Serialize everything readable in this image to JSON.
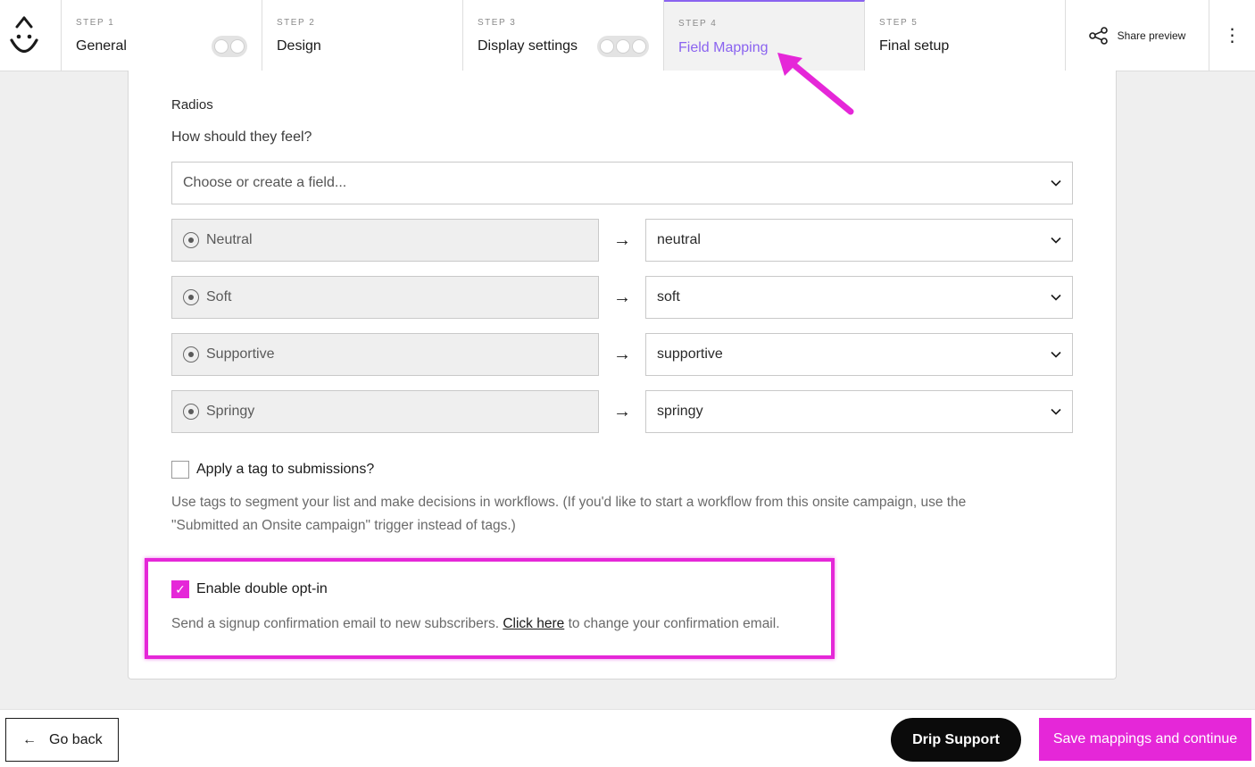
{
  "header": {
    "steps": [
      {
        "num": "STEP 1",
        "title": "General"
      },
      {
        "num": "STEP 2",
        "title": "Design"
      },
      {
        "num": "STEP 3",
        "title": "Display settings"
      },
      {
        "num": "STEP 4",
        "title": "Field Mapping"
      },
      {
        "num": "STEP 5",
        "title": "Final setup"
      }
    ],
    "share_label": "Share preview",
    "more_icon": "⋮"
  },
  "mapping": {
    "section_label": "Radios",
    "question": "How should they feel?",
    "field_select_placeholder": "Choose or create a field...",
    "rows": [
      {
        "option": "Neutral",
        "value": "neutral"
      },
      {
        "option": "Soft",
        "value": "soft"
      },
      {
        "option": "Supportive",
        "value": "supportive"
      },
      {
        "option": "Springy",
        "value": "springy"
      }
    ],
    "arrow": "→"
  },
  "tags": {
    "label": "Apply a tag to submissions?",
    "help": "Use tags to segment your list and make decisions in workflows. (If you'd like to start a workflow from this onsite campaign, use the \"Submitted an Onsite campaign\" trigger instead of tags.)"
  },
  "double_opt_in": {
    "label": "Enable double opt-in",
    "help_before": "Send a signup confirmation email to new subscribers.",
    "link": "Click here",
    "help_after": "to change your confirmation email.",
    "checkmark": "✓"
  },
  "footer": {
    "back_label": "Go back",
    "back_arrow": "←",
    "support_label": "Drip Support",
    "save_label": "Save mappings and continue"
  },
  "colors": {
    "accent_pink": "#e527d8",
    "active_step": "#8a63f0"
  }
}
